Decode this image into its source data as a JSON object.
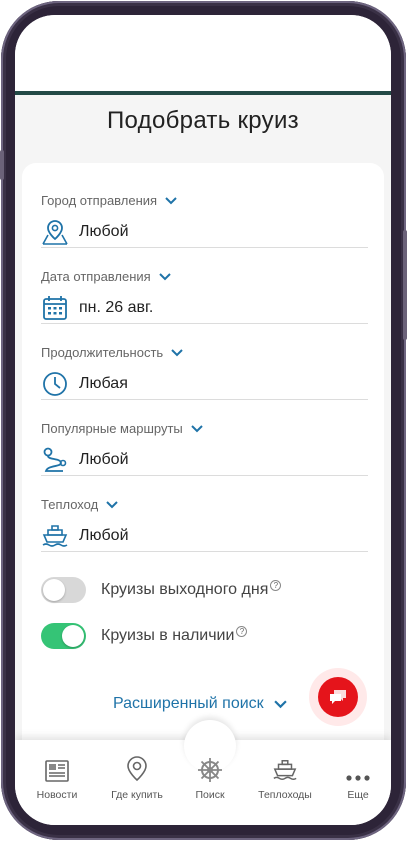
{
  "page": {
    "title": "Подобрать круиз"
  },
  "fields": [
    {
      "label": "Город отправления",
      "value": "Любой",
      "icon": "map-pin-icon"
    },
    {
      "label": "Дата отправления",
      "value": "пн. 26 авг.",
      "icon": "calendar-icon"
    },
    {
      "label": "Продолжительность",
      "value": "Любая",
      "icon": "clock-icon"
    },
    {
      "label": "Популярные маршруты",
      "value": "Любой",
      "icon": "route-icon"
    },
    {
      "label": "Теплоход",
      "value": "Любой",
      "icon": "ship-icon"
    }
  ],
  "toggles": [
    {
      "label": "Круизы выходного дня",
      "on": false
    },
    {
      "label": "Круизы в наличии",
      "on": true
    }
  ],
  "help_mark": "?",
  "advanced_search": "Расширенный поиск",
  "tabs": [
    {
      "label": "Новости",
      "icon": "newspaper-icon"
    },
    {
      "label": "Где купить",
      "icon": "location-icon"
    },
    {
      "label": "Поиск",
      "icon": "wheel-icon"
    },
    {
      "label": "Теплоходы",
      "icon": "ship-icon"
    },
    {
      "label": "Еще",
      "icon": "more-icon"
    }
  ],
  "colors": {
    "accent": "#1f73a8",
    "toggle_on": "#35c476",
    "chat": "#e5141b",
    "header_line": "#234a46"
  }
}
